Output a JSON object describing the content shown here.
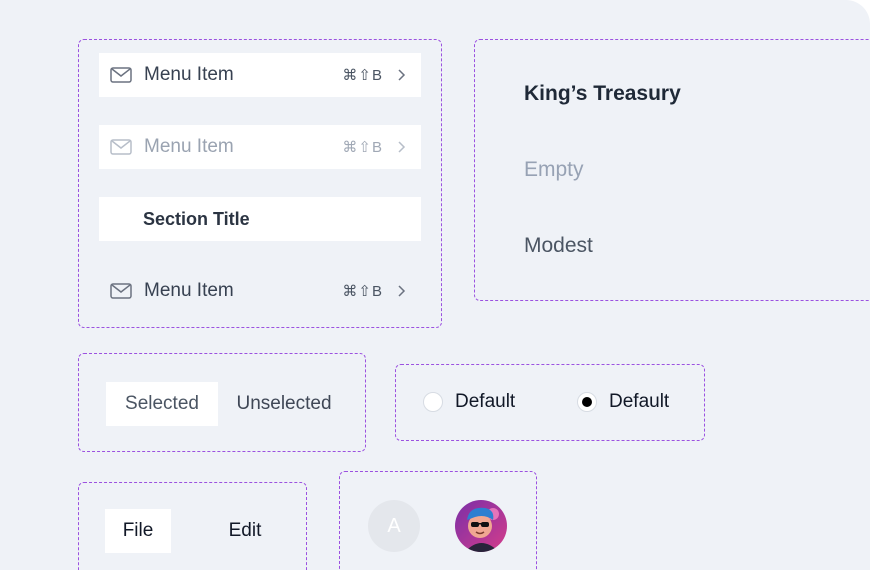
{
  "menu": {
    "items": [
      {
        "label": "Menu Item",
        "shortcut": "⌘⇧B",
        "state": "default"
      },
      {
        "label": "Menu Item",
        "shortcut": "⌘⇧B",
        "state": "disabled"
      },
      {
        "label": "Section Title",
        "state": "section"
      },
      {
        "label": "Menu Item",
        "shortcut": "⌘⇧B",
        "state": "default"
      }
    ]
  },
  "treasury": {
    "title": "King’s Treasury",
    "empty": "Empty",
    "modest": "Modest"
  },
  "segmented": {
    "selected": "Selected",
    "unselected": "Unselected"
  },
  "radios": [
    {
      "label": "Default",
      "checked": false
    },
    {
      "label": "Default",
      "checked": true
    }
  ],
  "tabs": {
    "file": "File",
    "edit": "Edit"
  },
  "avatars": {
    "initial": "A"
  },
  "colors": {
    "dashed_border": "#9b51e0",
    "background": "#eff2f7"
  }
}
